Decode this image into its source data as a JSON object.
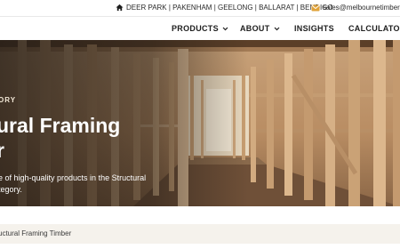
{
  "topbar": {
    "locations": "DEER PARK | PAKENHAM | GEELONG | BALLARAT | BENDIGO",
    "email": "sales@melbournetimber"
  },
  "nav": {
    "items": [
      {
        "label": "PRODUCTS",
        "dropdown": true
      },
      {
        "label": "ABOUT",
        "dropdown": true
      },
      {
        "label": "INSIGHTS",
        "dropdown": false
      },
      {
        "label": "CALCULATOR",
        "dropdown": false
      }
    ]
  },
  "hero": {
    "eyebrow": "ORY",
    "title_line1": "ural Framing",
    "title_line2": "r",
    "desc_line1": "e of high-quality products in the Structural",
    "desc_line2": "tegory."
  },
  "breadcrumb": {
    "current": "uctural Framing Timber"
  },
  "colors": {
    "hero_overlay": "#231c16",
    "breadcrumb_bg": "#f5f2ec",
    "email_icon": "#e0a33a"
  },
  "icons": {
    "home": "home-icon",
    "email": "mail-icon",
    "dropdown": "chevron-down-icon"
  }
}
